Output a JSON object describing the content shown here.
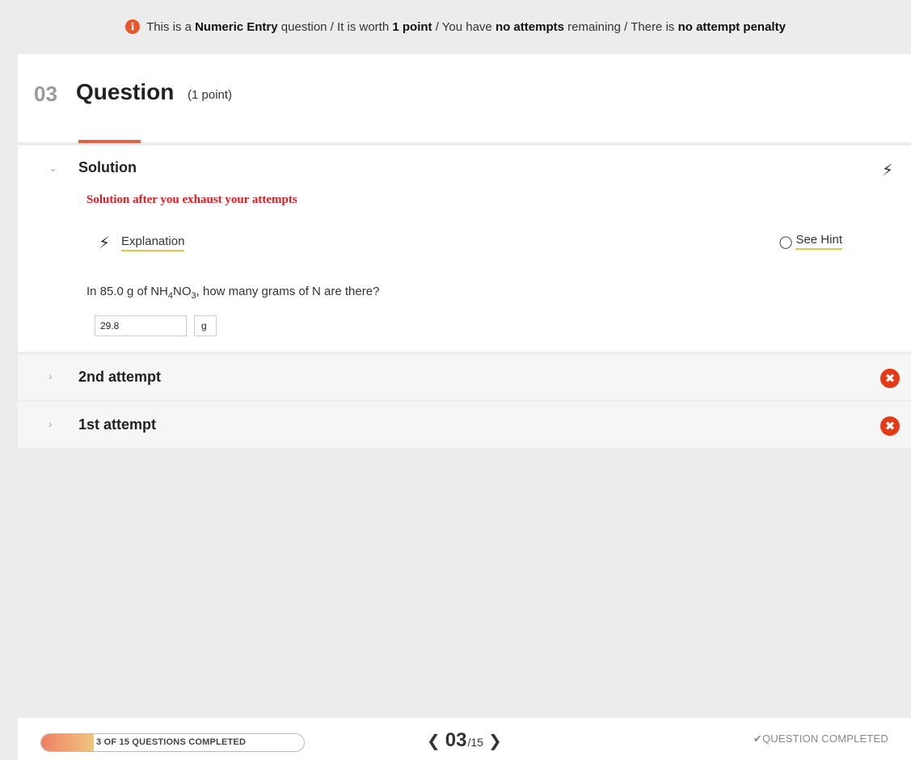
{
  "info_bar": {
    "pre1": "This is a ",
    "type": "Numeric Entry",
    "mid1": " question / It is worth ",
    "points": "1 point",
    "mid2": " / You have ",
    "attempts": "no attempts",
    "mid3": " remaining / There is ",
    "penalty": "no attempt penalty"
  },
  "question": {
    "number": "03",
    "title": "Question",
    "points_label": "(1 point)"
  },
  "solution": {
    "title": "Solution",
    "note": "Solution after you exhaust your attempts",
    "explanation_label": "Explanation",
    "hint_label": "See Hint",
    "prompt_pre": "In 85.0 g of NH",
    "sub1": "4",
    "prompt_mid": "NO",
    "sub2": "3",
    "prompt_post": ", how many grams of N are there?",
    "answer_value": "29.8",
    "unit": "g"
  },
  "attempts": [
    {
      "label": "2nd attempt",
      "status": "incorrect"
    },
    {
      "label": "1st attempt",
      "status": "incorrect"
    }
  ],
  "footer": {
    "progress_label": "3 OF 15 QUESTIONS COMPLETED",
    "progress_fraction": 0.2,
    "current": "03",
    "total": "/15",
    "completed_label": "✔QUESTION COMPLETED"
  },
  "colors": {
    "accent": "#e8613c",
    "error": "#e43a16",
    "note_red": "#d92020",
    "link_underline": "#e3c24a"
  },
  "icons": {
    "info": "info-icon",
    "bolt": "lightning-bolt-icon",
    "hint": "lightbulb-icon",
    "incorrect": "close-circle-icon"
  }
}
